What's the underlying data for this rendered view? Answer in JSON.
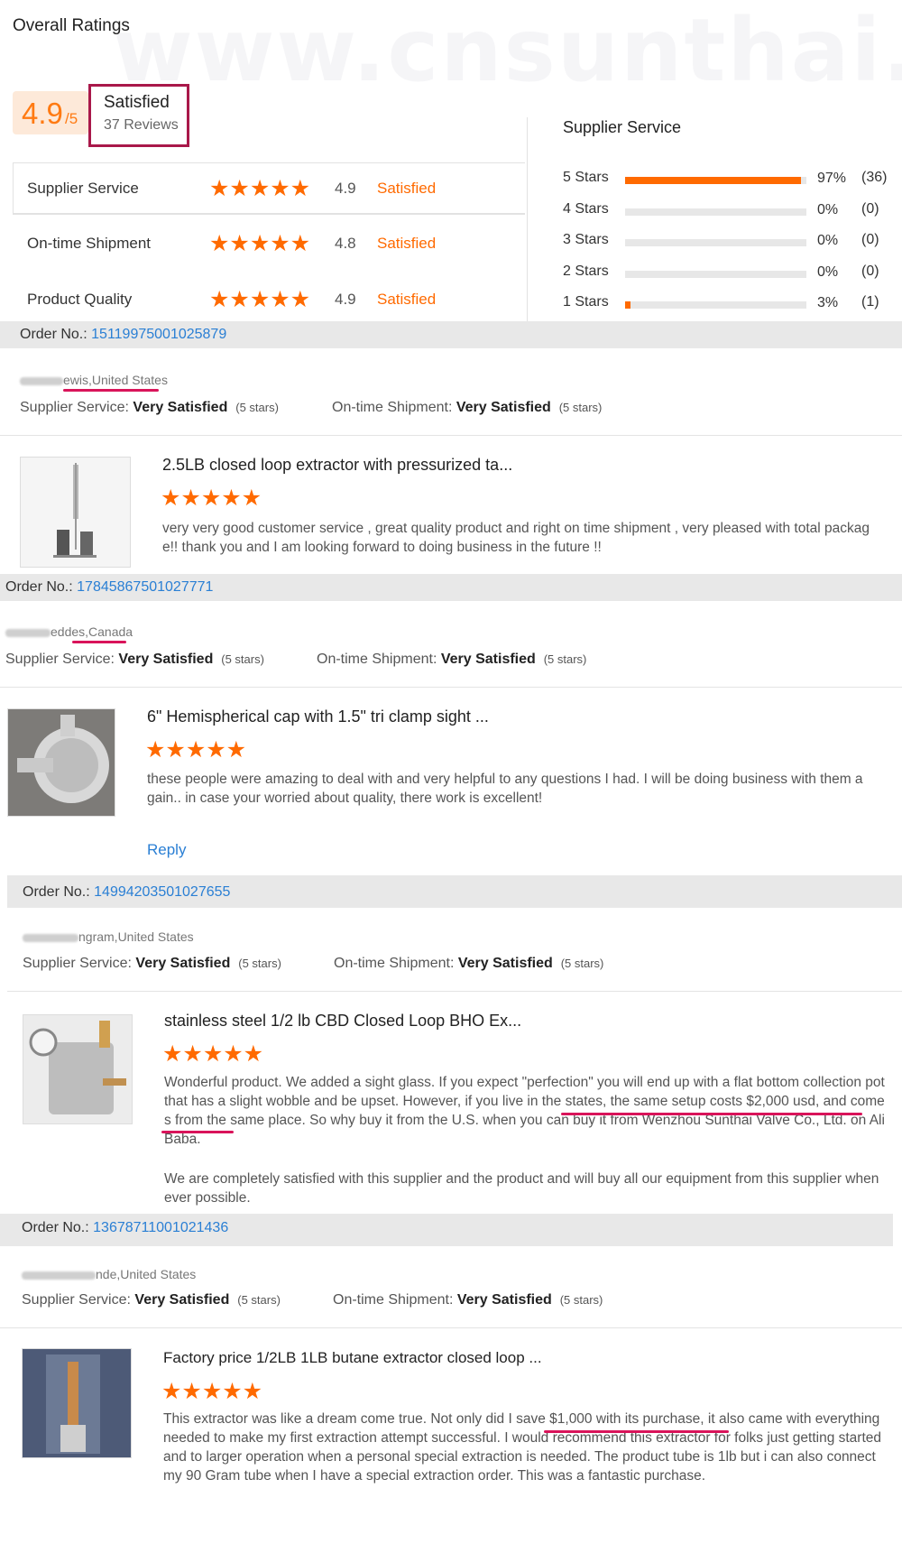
{
  "watermark": "www.cnsunthai.com",
  "overall": {
    "title": "Overall Ratings",
    "score": "4.9",
    "score_out_of": "/5",
    "label": "Satisfied",
    "reviews": "37 Reviews"
  },
  "ratings": [
    {
      "label": "Supplier Service",
      "stars": "★★★★★",
      "value": "4.9",
      "text": "Satisfied"
    },
    {
      "label": "On-time Shipment",
      "stars": "★★★★★",
      "value": "4.8",
      "text": "Satisfied"
    },
    {
      "label": "Product Quality",
      "stars": "★★★★★",
      "value": "4.9",
      "text": "Satisfied"
    }
  ],
  "distribution": {
    "title": "Supplier Service",
    "rows": [
      {
        "label": "5 Stars",
        "pct": "97%",
        "count": "(36)",
        "fraction": 0.97
      },
      {
        "label": "4 Stars",
        "pct": "0%",
        "count": "(0)",
        "fraction": 0
      },
      {
        "label": "3 Stars",
        "pct": "0%",
        "count": "(0)",
        "fraction": 0
      },
      {
        "label": "2 Stars",
        "pct": "0%",
        "count": "(0)",
        "fraction": 0
      },
      {
        "label": "1 Stars",
        "pct": "3%",
        "count": "(1)",
        "fraction": 0.03
      }
    ]
  },
  "common": {
    "order_label": "Order No.:",
    "supplier_label": "Supplier Service:",
    "shipment_label": "On-time Shipment:",
    "very_satisfied": "Very Satisfied",
    "five_stars": "(5 stars)",
    "stars": "★★★★★",
    "reply": "Reply"
  },
  "reviews": [
    {
      "order_no": "15119975001025879",
      "buyer": "ewis,United States",
      "title": "2.5LB closed loop extractor with pressurized ta...",
      "text": "very very good customer service , great quality product and right on time shipment , very pleased with total package!! thank you and I am looking forward to doing business in the future !!"
    },
    {
      "order_no": "17845867501027771",
      "buyer": "eddes,Canada",
      "title": "6\" Hemispherical cap with 1.5\" tri clamp sight ...",
      "text": "these people were amazing to deal with and very helpful to any questions I had. I will be doing business with them again.. in case your worried about quality, there work is excellent!"
    },
    {
      "order_no": "14994203501027655",
      "buyer": "ngram,United States",
      "title": "stainless steel 1/2 lb CBD Closed Loop BHO Ex...",
      "text": "Wonderful product. We added a sight glass. If you expect \"perfection\" you will end up with a flat bottom collection pot that has a slight wobble and be upset. However, if you live in the states, the same setup costs $2,000 usd, and comes from the same place. So why buy it from the U.S. when you can buy it from Wenzhou Sunthai Valve Co., Ltd. on AliBaba.",
      "text2": "We are completely satisfied with this supplier and the product and will buy all our equipment from this supplier whenever possible."
    },
    {
      "order_no": "13678711001021436",
      "buyer": "nde,United States",
      "title": "Factory price 1/2LB 1LB butane extractor closed loop ...",
      "text": "This extractor was like a dream come true. Not only did I save $1,000 with its purchase, it also came with everything needed to make my first extraction attempt successful. I would recommend this extractor for folks just getting started and to larger operation when a personal special extraction is needed. The product tube is 1lb but i can also connect my 90 Gram tube when I have a special extraction order. This was a fantastic purchase."
    }
  ]
}
